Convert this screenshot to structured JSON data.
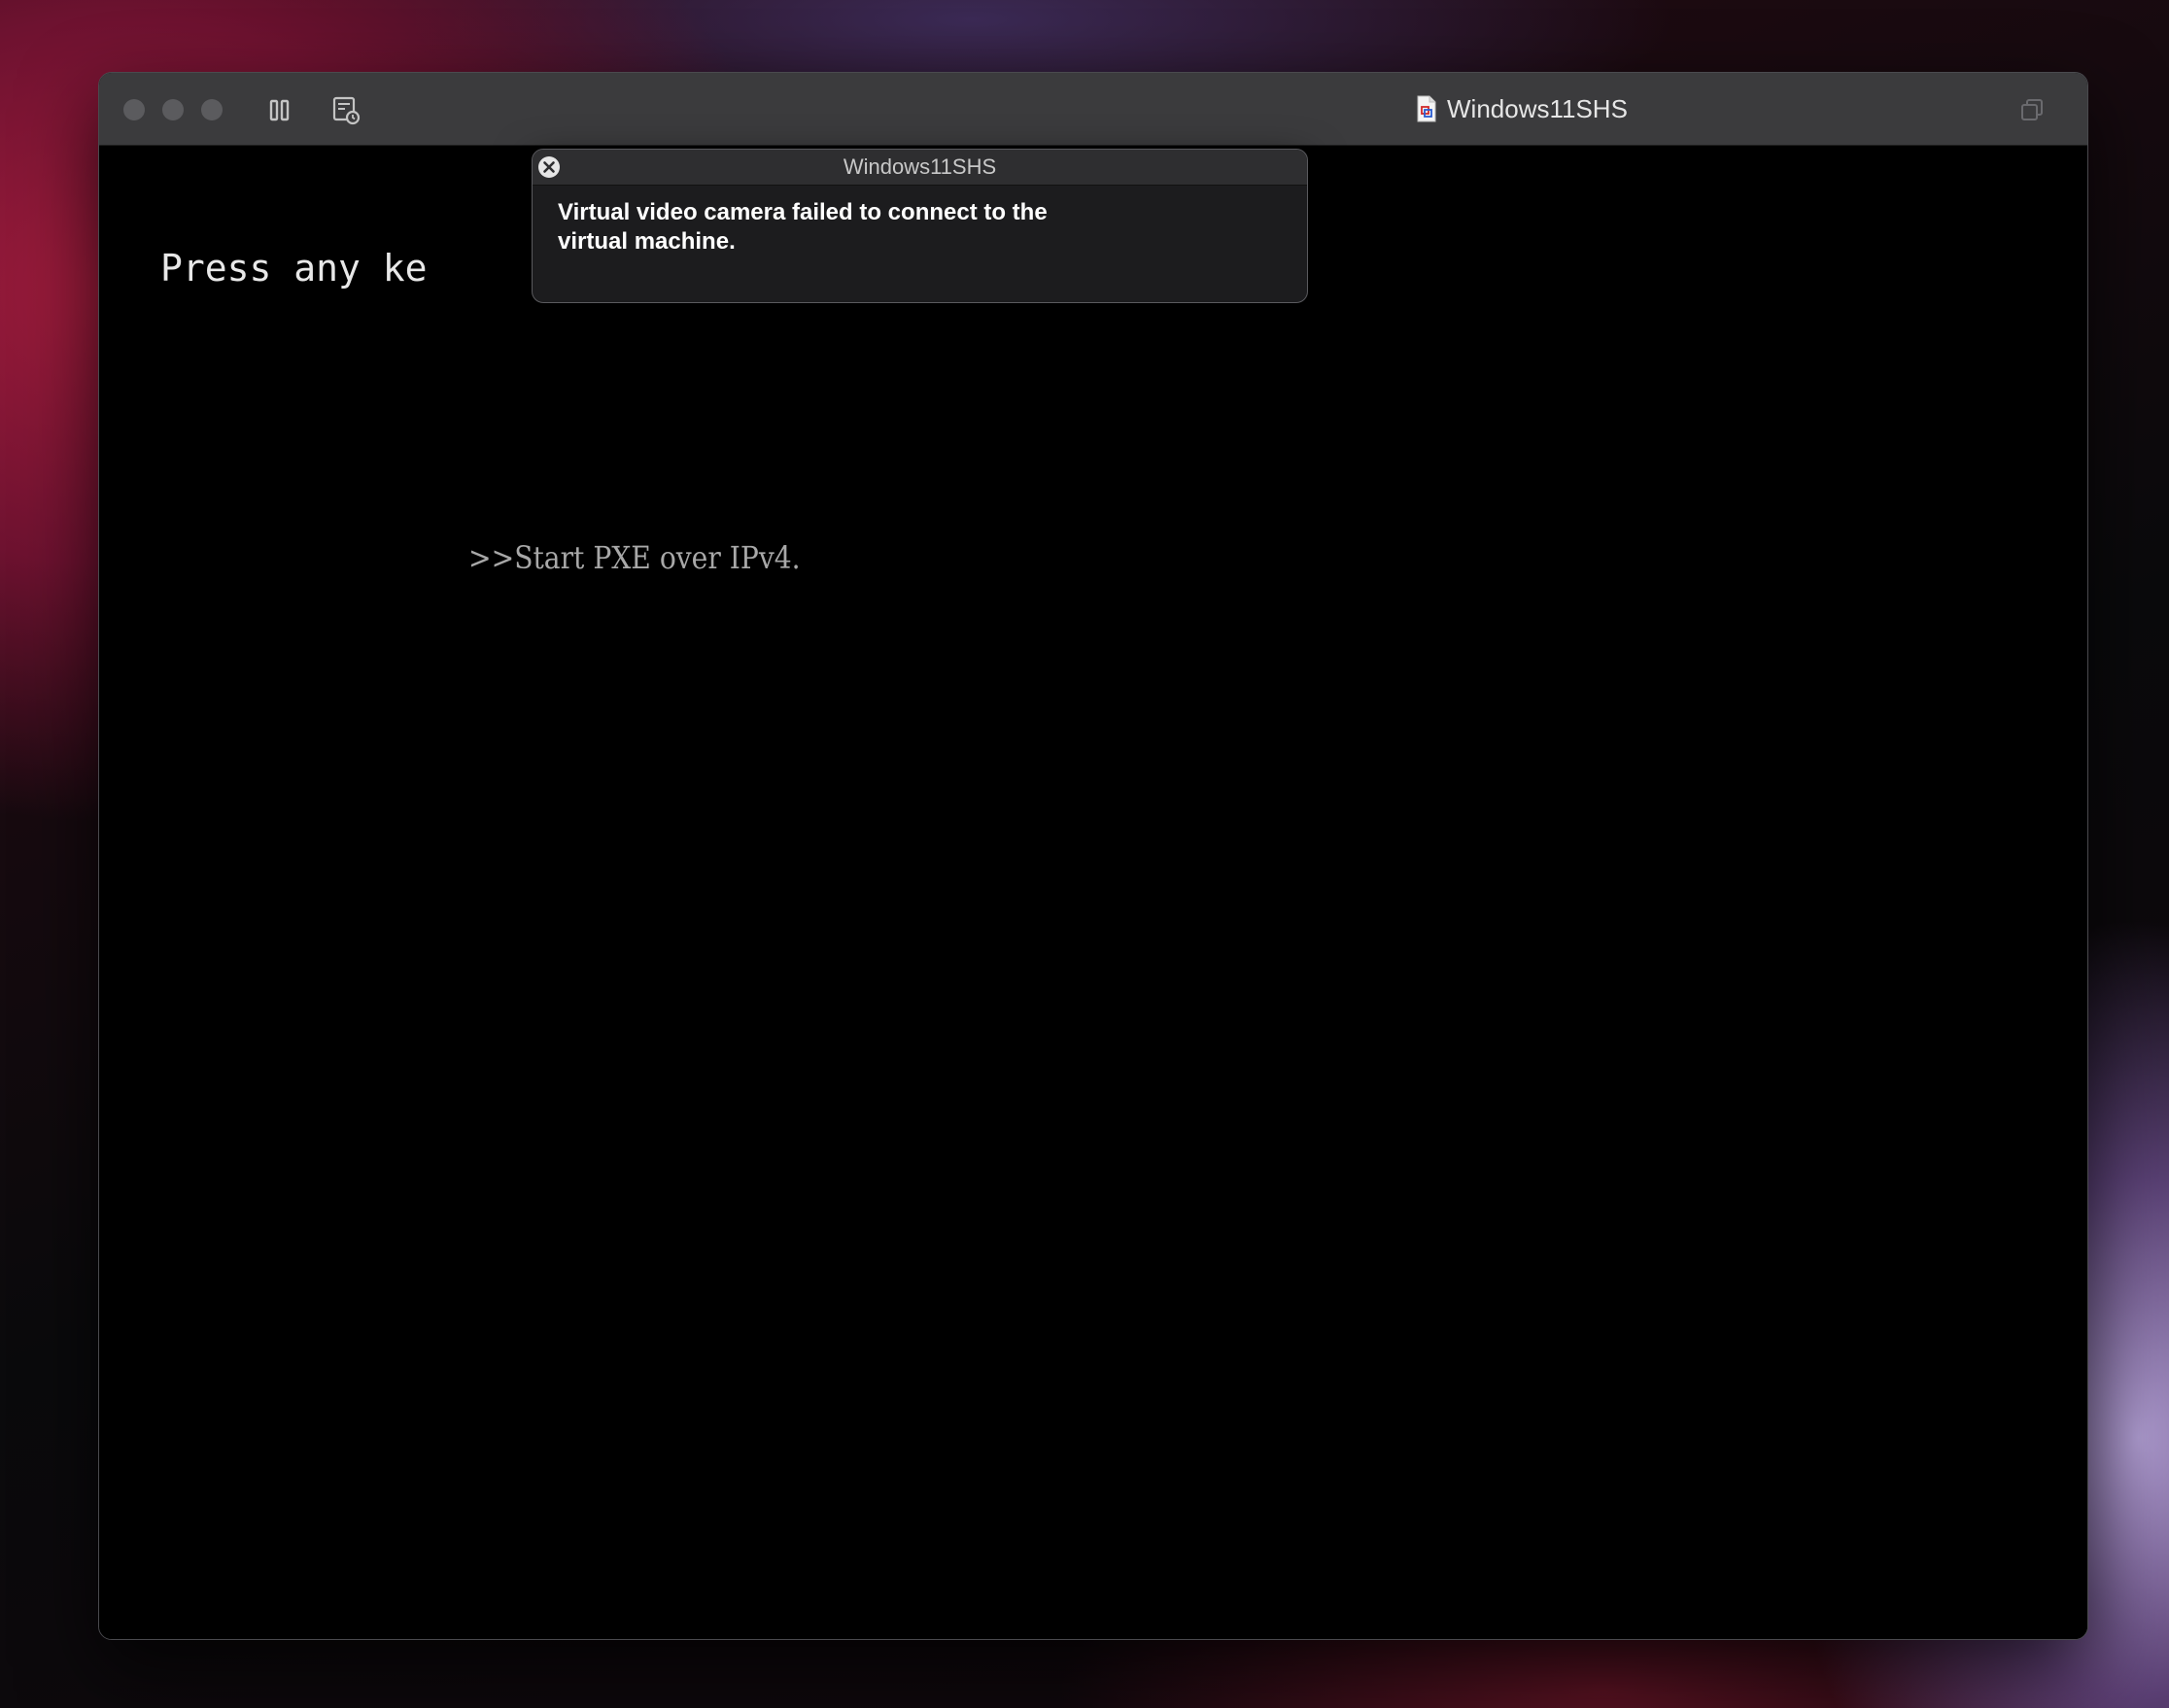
{
  "window": {
    "title": "Windows11SHS",
    "doc_icon": "vm-document-icon",
    "traffic_lights": [
      "close",
      "minimize",
      "zoom"
    ],
    "toolbar_icons": [
      "pause-icon",
      "snapshot-icon"
    ],
    "restore_icon": "restore-window-icon"
  },
  "screen": {
    "press_text": "Press any ke",
    "pxe_text": ">>Start PXE over IPv4."
  },
  "notification": {
    "title": "Windows11SHS",
    "message": "Virtual video camera failed to connect to the virtual machine.",
    "close_icon": "close-circle-icon"
  },
  "colors": {
    "titlebar": "#3b3b3d",
    "screen_bg": "#000000",
    "notification_bg": "#1c1c1e"
  }
}
